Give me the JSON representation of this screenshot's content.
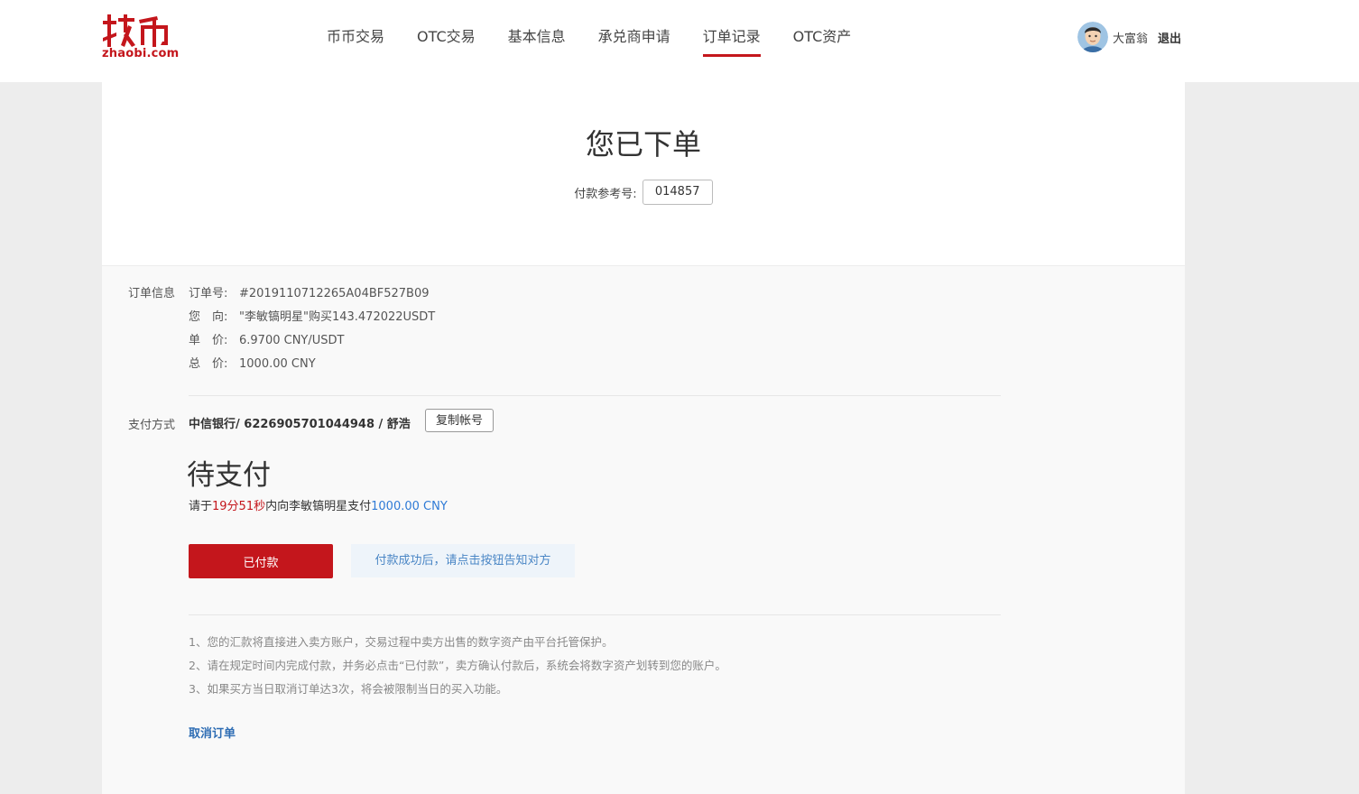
{
  "header": {
    "logo_text": "zhaobi.com",
    "nav": [
      {
        "label": "币币交易"
      },
      {
        "label": "OTC交易"
      },
      {
        "label": "基本信息"
      },
      {
        "label": "承兑商申请"
      },
      {
        "label": "订单记录",
        "active": true
      },
      {
        "label": "OTC资产"
      }
    ],
    "username": "大富翁",
    "logout": "退出"
  },
  "order": {
    "title": "您已下单",
    "ref_label": "付款参考号:",
    "ref_value": "014857",
    "info_label": "订单信息",
    "rows": [
      {
        "key": "订单号:",
        "value": "#2019110712265A04BF527B09"
      },
      {
        "key": "您　向:",
        "value": "\"李敏镐明星\"购买143.472022USDT"
      },
      {
        "key": "单　价:",
        "value": "6.9700 CNY/USDT"
      },
      {
        "key": "总　价:",
        "value": "1000.00 CNY"
      }
    ],
    "payment_label": "支付方式",
    "payment_detail": "中信银行/ 6226905701044948 / 舒浩",
    "copy_button": "复制帐号",
    "status": "待支付",
    "countdown": {
      "prefix": "请于",
      "time": "19分51秒",
      "middle": "内向李敏镐明星支付",
      "amount": "1000.00 CNY"
    },
    "paid_button": "已付款",
    "hint": "付款成功后，请点击按钮告知对方",
    "notes": [
      "1、您的汇款将直接进入卖方账户，交易过程中卖方出售的数字资产由平台托管保护。",
      "2、请在规定时间内完成付款，并务必点击“已付款”，卖方确认付款后，系统会将数字资产划转到您的账户。",
      "3、如果买方当日取消订单达3次，将会被限制当日的买入功能。"
    ],
    "cancel": "取消订单"
  },
  "colors": {
    "brand_red": "#c4161c",
    "link_blue": "#2e7ad6"
  }
}
